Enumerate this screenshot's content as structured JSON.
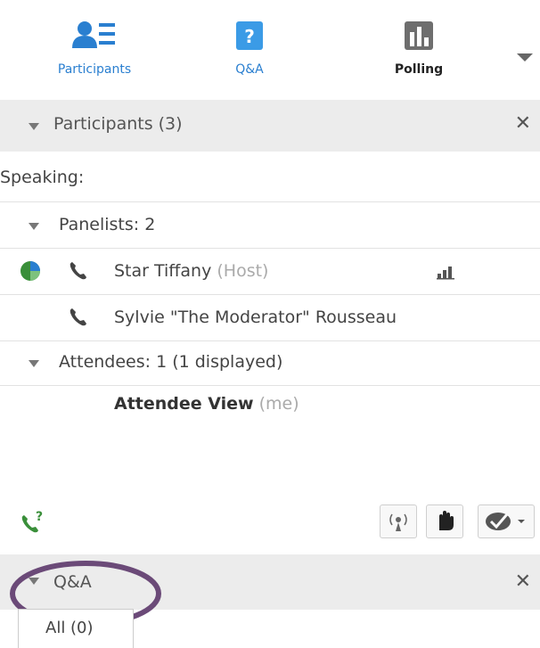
{
  "toolbar": {
    "participants_label": "Participants",
    "qa_label": "Q&A",
    "polling_label": "Polling"
  },
  "participants_panel": {
    "header": "Participants (3)",
    "speaking_label": "Speaking:",
    "panelists_label": "Panelists: 2",
    "panelists": [
      {
        "name": "Star Tiffany",
        "role": "(Host)"
      },
      {
        "name": "Sylvie \"The Moderator\" Rousseau",
        "role": ""
      }
    ],
    "attendees_label": "Attendees: 1 (1 displayed)",
    "attendees": [
      {
        "name": "Attendee View",
        "tag": "(me)"
      }
    ]
  },
  "qa_panel": {
    "header": "Q&A",
    "tab_all_label": "All (0)"
  },
  "colors": {
    "accent_blue": "#2a7fd0",
    "header_bg": "#ececec",
    "annotation_purple": "#6b4a78",
    "green_icon": "#3a8f3a"
  }
}
